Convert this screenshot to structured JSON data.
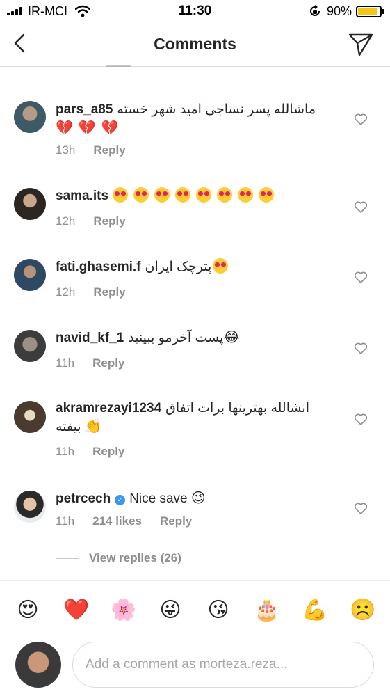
{
  "status_bar": {
    "carrier": "IR-MCI",
    "time": "11:30",
    "battery_percent": "90%",
    "battery_level": 0.9
  },
  "header": {
    "title": "Comments"
  },
  "comments": [
    {
      "username": "pars_a85",
      "text": "ماشالله پسر نساجی امید شهر خسته",
      "emojis": [
        "💔",
        "💔",
        "💔"
      ],
      "time": "13h",
      "reply_label": "Reply"
    },
    {
      "username": "sama.its",
      "text": "",
      "emojis": [
        "😍",
        "😍",
        "😍",
        "😍",
        "😍",
        "😍",
        "😍",
        "😍"
      ],
      "time": "12h",
      "reply_label": "Reply"
    },
    {
      "username": "fati.ghasemi.f",
      "text": "پترچک ایران",
      "emojis": [
        "😍"
      ],
      "time": "12h",
      "reply_label": "Reply"
    },
    {
      "username": "navid_kf_1",
      "text": "پست آخرمو ببینید",
      "emojis": [
        "😂"
      ],
      "time": "11h",
      "reply_label": "Reply"
    },
    {
      "username": "akramrezayi1234",
      "text": "انشالله بهترینها برات اتفاق بیفته",
      "emojis": [
        "👏"
      ],
      "time": "11h",
      "reply_label": "Reply"
    },
    {
      "username": "petrcech",
      "verified": true,
      "text": "Nice save",
      "emojis": [
        "😉"
      ],
      "time": "11h",
      "likes": "214 likes",
      "reply_label": "Reply"
    }
  ],
  "view_replies": "View replies (26)",
  "emoji_bar": [
    "😍",
    "❤️",
    "🌸",
    "😜",
    "😘",
    "🎂",
    "💪",
    "☹️"
  ],
  "composer": {
    "placeholder": "Add a comment as morteza.reza..."
  },
  "colors": {
    "text": "#262626",
    "secondary": "#8e8e8e",
    "border": "#dbdbdb",
    "verified": "#3897f0",
    "battery": "#f5c518"
  },
  "icons": [
    "back-chevron-icon",
    "send-icon",
    "heart-outline-icon",
    "wifi-icon",
    "rotation-lock-icon",
    "verified-badge-icon"
  ]
}
